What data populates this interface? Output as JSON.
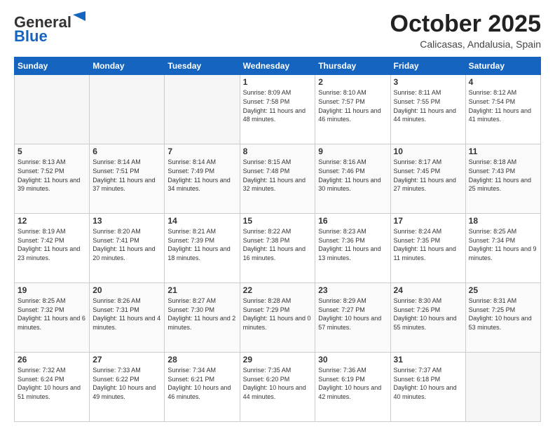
{
  "logo": {
    "general": "General",
    "blue": "Blue"
  },
  "header": {
    "month": "October 2025",
    "location": "Calicasas, Andalusia, Spain"
  },
  "days_of_week": [
    "Sunday",
    "Monday",
    "Tuesday",
    "Wednesday",
    "Thursday",
    "Friday",
    "Saturday"
  ],
  "weeks": [
    [
      {
        "day": "",
        "info": ""
      },
      {
        "day": "",
        "info": ""
      },
      {
        "day": "",
        "info": ""
      },
      {
        "day": "1",
        "info": "Sunrise: 8:09 AM\nSunset: 7:58 PM\nDaylight: 11 hours and 48 minutes."
      },
      {
        "day": "2",
        "info": "Sunrise: 8:10 AM\nSunset: 7:57 PM\nDaylight: 11 hours and 46 minutes."
      },
      {
        "day": "3",
        "info": "Sunrise: 8:11 AM\nSunset: 7:55 PM\nDaylight: 11 hours and 44 minutes."
      },
      {
        "day": "4",
        "info": "Sunrise: 8:12 AM\nSunset: 7:54 PM\nDaylight: 11 hours and 41 minutes."
      }
    ],
    [
      {
        "day": "5",
        "info": "Sunrise: 8:13 AM\nSunset: 7:52 PM\nDaylight: 11 hours and 39 minutes."
      },
      {
        "day": "6",
        "info": "Sunrise: 8:14 AM\nSunset: 7:51 PM\nDaylight: 11 hours and 37 minutes."
      },
      {
        "day": "7",
        "info": "Sunrise: 8:14 AM\nSunset: 7:49 PM\nDaylight: 11 hours and 34 minutes."
      },
      {
        "day": "8",
        "info": "Sunrise: 8:15 AM\nSunset: 7:48 PM\nDaylight: 11 hours and 32 minutes."
      },
      {
        "day": "9",
        "info": "Sunrise: 8:16 AM\nSunset: 7:46 PM\nDaylight: 11 hours and 30 minutes."
      },
      {
        "day": "10",
        "info": "Sunrise: 8:17 AM\nSunset: 7:45 PM\nDaylight: 11 hours and 27 minutes."
      },
      {
        "day": "11",
        "info": "Sunrise: 8:18 AM\nSunset: 7:43 PM\nDaylight: 11 hours and 25 minutes."
      }
    ],
    [
      {
        "day": "12",
        "info": "Sunrise: 8:19 AM\nSunset: 7:42 PM\nDaylight: 11 hours and 23 minutes."
      },
      {
        "day": "13",
        "info": "Sunrise: 8:20 AM\nSunset: 7:41 PM\nDaylight: 11 hours and 20 minutes."
      },
      {
        "day": "14",
        "info": "Sunrise: 8:21 AM\nSunset: 7:39 PM\nDaylight: 11 hours and 18 minutes."
      },
      {
        "day": "15",
        "info": "Sunrise: 8:22 AM\nSunset: 7:38 PM\nDaylight: 11 hours and 16 minutes."
      },
      {
        "day": "16",
        "info": "Sunrise: 8:23 AM\nSunset: 7:36 PM\nDaylight: 11 hours and 13 minutes."
      },
      {
        "day": "17",
        "info": "Sunrise: 8:24 AM\nSunset: 7:35 PM\nDaylight: 11 hours and 11 minutes."
      },
      {
        "day": "18",
        "info": "Sunrise: 8:25 AM\nSunset: 7:34 PM\nDaylight: 11 hours and 9 minutes."
      }
    ],
    [
      {
        "day": "19",
        "info": "Sunrise: 8:25 AM\nSunset: 7:32 PM\nDaylight: 11 hours and 6 minutes."
      },
      {
        "day": "20",
        "info": "Sunrise: 8:26 AM\nSunset: 7:31 PM\nDaylight: 11 hours and 4 minutes."
      },
      {
        "day": "21",
        "info": "Sunrise: 8:27 AM\nSunset: 7:30 PM\nDaylight: 11 hours and 2 minutes."
      },
      {
        "day": "22",
        "info": "Sunrise: 8:28 AM\nSunset: 7:29 PM\nDaylight: 11 hours and 0 minutes."
      },
      {
        "day": "23",
        "info": "Sunrise: 8:29 AM\nSunset: 7:27 PM\nDaylight: 10 hours and 57 minutes."
      },
      {
        "day": "24",
        "info": "Sunrise: 8:30 AM\nSunset: 7:26 PM\nDaylight: 10 hours and 55 minutes."
      },
      {
        "day": "25",
        "info": "Sunrise: 8:31 AM\nSunset: 7:25 PM\nDaylight: 10 hours and 53 minutes."
      }
    ],
    [
      {
        "day": "26",
        "info": "Sunrise: 7:32 AM\nSunset: 6:24 PM\nDaylight: 10 hours and 51 minutes."
      },
      {
        "day": "27",
        "info": "Sunrise: 7:33 AM\nSunset: 6:22 PM\nDaylight: 10 hours and 49 minutes."
      },
      {
        "day": "28",
        "info": "Sunrise: 7:34 AM\nSunset: 6:21 PM\nDaylight: 10 hours and 46 minutes."
      },
      {
        "day": "29",
        "info": "Sunrise: 7:35 AM\nSunset: 6:20 PM\nDaylight: 10 hours and 44 minutes."
      },
      {
        "day": "30",
        "info": "Sunrise: 7:36 AM\nSunset: 6:19 PM\nDaylight: 10 hours and 42 minutes."
      },
      {
        "day": "31",
        "info": "Sunrise: 7:37 AM\nSunset: 6:18 PM\nDaylight: 10 hours and 40 minutes."
      },
      {
        "day": "",
        "info": ""
      }
    ]
  ]
}
